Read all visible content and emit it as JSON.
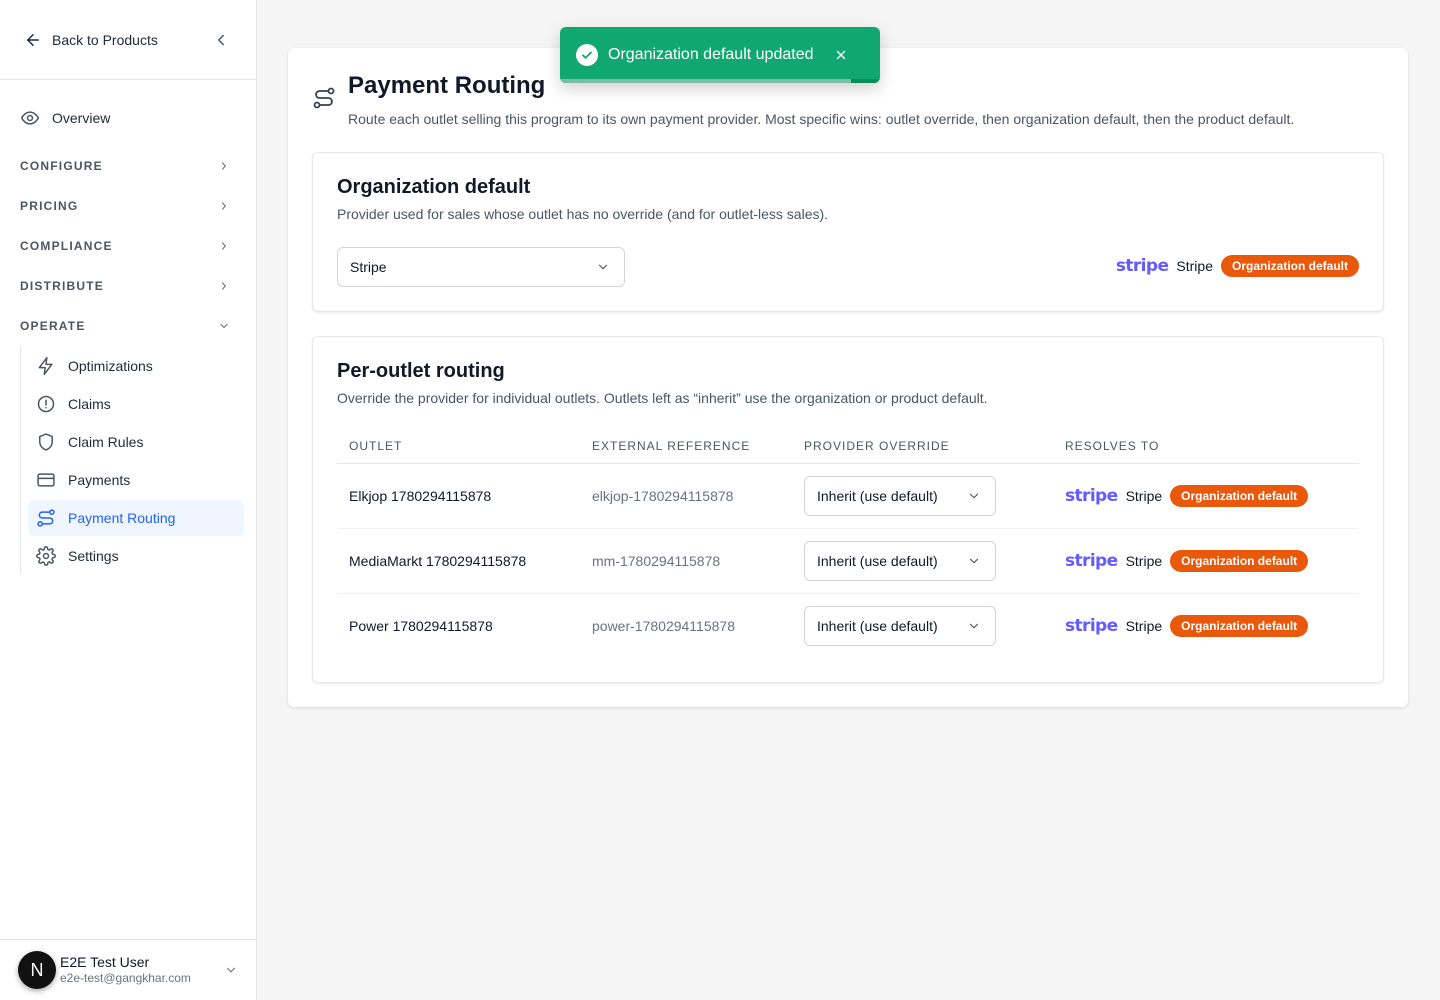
{
  "sidebar": {
    "back_label": "Back to Products",
    "overview_label": "Overview",
    "sections": [
      {
        "label": "CONFIGURE",
        "expanded": false
      },
      {
        "label": "PRICING",
        "expanded": false
      },
      {
        "label": "COMPLIANCE",
        "expanded": false
      },
      {
        "label": "DISTRIBUTE",
        "expanded": false
      },
      {
        "label": "OPERATE",
        "expanded": true
      }
    ],
    "operate_items": [
      {
        "label": "Optimizations",
        "icon": "lightning-icon",
        "active": false
      },
      {
        "label": "Claims",
        "icon": "alert-circle-icon",
        "active": false
      },
      {
        "label": "Claim Rules",
        "icon": "shield-icon",
        "active": false
      },
      {
        "label": "Payments",
        "icon": "credit-card-icon",
        "active": false
      },
      {
        "label": "Payment Routing",
        "icon": "route-icon",
        "active": true
      },
      {
        "label": "Settings",
        "icon": "gear-icon",
        "active": false
      }
    ],
    "user": {
      "initial": "N",
      "name": "E2E Test User",
      "email": "e2e-test@gangkhar.com"
    }
  },
  "page": {
    "title": "Payment Routing",
    "description": "Route each outlet selling this program to its own payment provider. Most specific wins: outlet override, then organization default, then the product default."
  },
  "org_default": {
    "title": "Organization default",
    "description": "Provider used for sales whose outlet has no override (and for outlet-less sales).",
    "selected_provider": "Stripe",
    "resolve": {
      "logo": "stripe",
      "provider": "Stripe",
      "badge": "Organization default"
    }
  },
  "per_outlet": {
    "title": "Per-outlet routing",
    "description": "Override the provider for individual outlets. Outlets left as “inherit” use the organization or product default.",
    "columns": [
      "OUTLET",
      "EXTERNAL REFERENCE",
      "PROVIDER OVERRIDE",
      "RESOLVES TO"
    ],
    "rows": [
      {
        "outlet": "Elkjop 1780294115878",
        "external_ref": "elkjop-1780294115878",
        "override": "Inherit (use default)",
        "logo": "stripe",
        "provider": "Stripe",
        "badge": "Organization default"
      },
      {
        "outlet": "MediaMarkt 1780294115878",
        "external_ref": "mm-1780294115878",
        "override": "Inherit (use default)",
        "logo": "stripe",
        "provider": "Stripe",
        "badge": "Organization default"
      },
      {
        "outlet": "Power 1780294115878",
        "external_ref": "power-1780294115878",
        "override": "Inherit (use default)",
        "logo": "stripe",
        "provider": "Stripe",
        "badge": "Organization default"
      }
    ]
  },
  "toast": {
    "message": "Organization default updated",
    "progress": 0.91
  },
  "colors": {
    "accent": "#2563eb",
    "badge": "#ea580c",
    "stripe": "#635bff",
    "toast": "#10a870"
  }
}
